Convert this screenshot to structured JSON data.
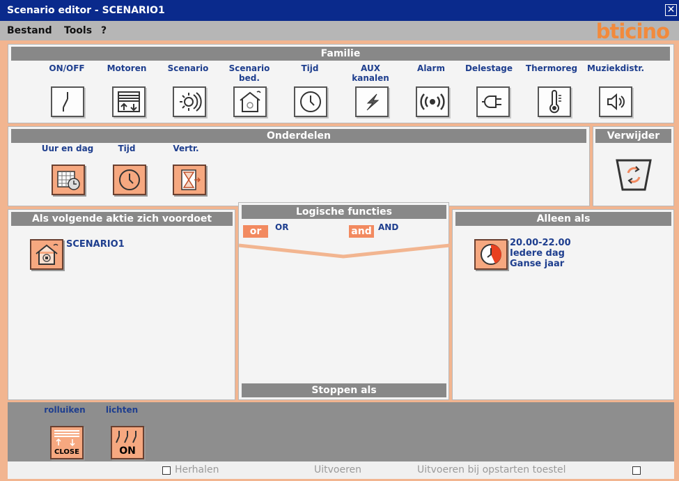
{
  "window": {
    "title": "Scenario editor - SCENARIO1",
    "close_glyph": "✕"
  },
  "menu": {
    "items": [
      "Bestand",
      "Tools",
      "?"
    ],
    "logo": "bticino"
  },
  "familie": {
    "title": "Familie",
    "items": [
      {
        "label": "ON/OFF",
        "icon": "switch-icon"
      },
      {
        "label": "Motoren",
        "icon": "shutter-icon"
      },
      {
        "label": "Scenario",
        "icon": "scenario-icon"
      },
      {
        "label": "Scenario\nbed.",
        "icon": "scenario-house-icon"
      },
      {
        "label": "Tijd",
        "icon": "clock-icon"
      },
      {
        "label": "AUX\nkanalen",
        "icon": "lightning-icon"
      },
      {
        "label": "Alarm",
        "icon": "alarm-icon"
      },
      {
        "label": "Delestage",
        "icon": "plug-icon"
      },
      {
        "label": "Thermoreg",
        "icon": "thermometer-icon"
      },
      {
        "label": "Muziekdistr.",
        "icon": "speaker-icon"
      }
    ]
  },
  "onderdelen": {
    "title": "Onderdelen",
    "items": [
      {
        "label": "Uur en dag",
        "icon": "calendar-clock-icon"
      },
      {
        "label": "Tijd",
        "icon": "clock-icon"
      },
      {
        "label": "Vertr.",
        "icon": "hourglass-icon"
      }
    ]
  },
  "verwijder": {
    "title": "Verwijder",
    "icon": "recycle-bin-icon"
  },
  "als": {
    "title": "Als volgende aktie zich voordoet",
    "item_label": "SCENARIO1"
  },
  "logische": {
    "title": "Logische functies",
    "or_tag": "or",
    "or_label": "OR",
    "and_tag": "and",
    "and_label": "AND",
    "stop_title": "Stoppen als"
  },
  "alleen": {
    "title": "Alleen als",
    "lines": [
      "20.00-22.00",
      "Iedere dag",
      "Ganse jaar"
    ]
  },
  "bottom": {
    "items": [
      {
        "label": "rolluiken",
        "icon": "shutter-close-icon",
        "badge": "CLOSE"
      },
      {
        "label": "lichten",
        "icon": "lights-on-icon",
        "badge": "ON"
      }
    ]
  },
  "footer": {
    "repeat": "Herhalen",
    "execute": "Uitvoeren",
    "execute_startup": "Uitvoeren bij opstarten toestel"
  },
  "colors": {
    "title_bar": "#0a2a8c",
    "accent": "#f28a60",
    "header_grey": "#888888",
    "label_blue": "#1e3e8e"
  }
}
